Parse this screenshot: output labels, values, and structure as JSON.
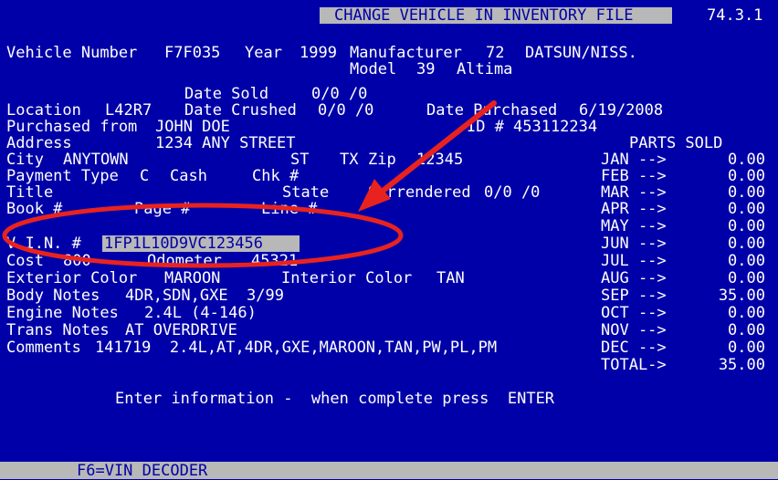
{
  "screen": {
    "title": "CHANGE VEHICLE IN INVENTORY FILE",
    "screen_id": "74.3.1"
  },
  "vehicle": {
    "vehicle_number_label": "Vehicle Number",
    "vehicle_number": "F7F035",
    "year_label": "Year",
    "year": "1999",
    "manufacturer_label": "Manufacturer",
    "manufacturer_code": "72",
    "manufacturer_name": "DATSUN/NISS.",
    "model_label": "Model",
    "model_code": "39",
    "model_name": "Altima"
  },
  "details": {
    "date_sold_label": "Date Sold",
    "date_sold": "0/0 /0",
    "location_label": "Location",
    "location": "L42R7",
    "date_crushed_label": "Date Crushed",
    "date_crushed": "0/0 /0",
    "date_purchased_label": "Date Purchased",
    "date_purchased": "6/19/2008",
    "purchased_from_label": "Purchased from",
    "purchased_from": "JOHN DOE",
    "id_label": "ID #",
    "id": "453112234",
    "address_label": "Address",
    "address": "1234 ANY STREET",
    "city_label": "City",
    "city": "ANYTOWN",
    "st_label": "ST",
    "st": "TX",
    "zip_label": "Zip",
    "zip": "12345",
    "payment_type_label": "Payment Type",
    "payment_type_code": "C",
    "payment_type": "Cash",
    "chk_label": "Chk #",
    "title_label": "Title",
    "state_label": "State",
    "surrendered_label": "Surrendered",
    "surrendered": "0/0 /0",
    "book_label": "Book #",
    "page_label": "Page #",
    "line_label": "Line #",
    "vin_label": "V.I.N. #",
    "vin": "1FP1L10D9VC123456",
    "cost_label": "Cost",
    "cost": "800",
    "odometer_label": "Odometer",
    "odometer": "45321",
    "exterior_color_label": "Exterior Color",
    "exterior_color": "MAROON",
    "interior_color_label": "Interior Color",
    "interior_color": "TAN",
    "body_notes_label": "Body Notes",
    "body_notes": "4DR,SDN,GXE  3/99",
    "engine_notes_label": "Engine Notes",
    "engine_notes": "2.4L (4-146)",
    "trans_notes_label": "Trans Notes",
    "trans_notes": "AT OVERDRIVE",
    "comments_label": "Comments",
    "comments": "141719  2.4L,AT,4DR,GXE,MAROON,TAN,PW,PL,PM"
  },
  "parts_sold": {
    "header": "PARTS SOLD",
    "months": [
      {
        "label": "JAN -->",
        "value": "0.00"
      },
      {
        "label": "FEB -->",
        "value": "0.00"
      },
      {
        "label": "MAR -->",
        "value": "0.00"
      },
      {
        "label": "APR -->",
        "value": "0.00"
      },
      {
        "label": "MAY -->",
        "value": "0.00"
      },
      {
        "label": "JUN -->",
        "value": "0.00"
      },
      {
        "label": "JUL -->",
        "value": "0.00"
      },
      {
        "label": "AUG -->",
        "value": "0.00"
      },
      {
        "label": "SEP -->",
        "value": "35.00"
      },
      {
        "label": "OCT -->",
        "value": "0.00"
      },
      {
        "label": "NOV -->",
        "value": "0.00"
      },
      {
        "label": "DEC -->",
        "value": "0.00"
      }
    ],
    "total_label": "TOTAL->",
    "total": "35.00"
  },
  "prompt": "Enter information -  when complete press  ENTER",
  "function_keys": {
    "f6": "F6=VIN DECODER"
  },
  "colors": {
    "background": "#0000a8",
    "text": "#ffffff",
    "highlight": "#b8b8b8",
    "annotation": "#e8231f"
  }
}
